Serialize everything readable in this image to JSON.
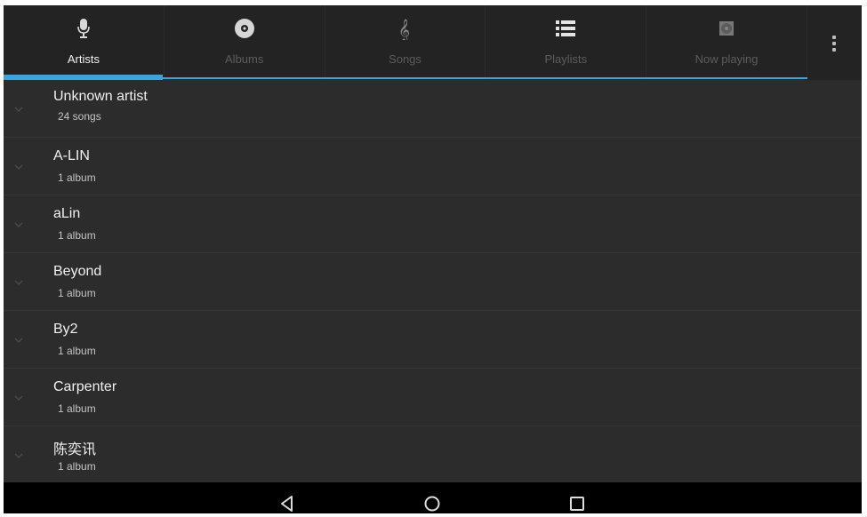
{
  "tabs": [
    {
      "label": "Artists",
      "icon": "microphone-icon",
      "active": true
    },
    {
      "label": "Albums",
      "icon": "disc-icon",
      "active": false
    },
    {
      "label": "Songs",
      "icon": "treble-clef-icon",
      "active": false
    },
    {
      "label": "Playlists",
      "icon": "list-icon",
      "active": false
    },
    {
      "label": "Now playing",
      "icon": "now-playing-icon",
      "active": false
    }
  ],
  "overflow_menu_icon": "more-vert-icon",
  "artists": [
    {
      "name": "Unknown artist",
      "count": "24 songs"
    },
    {
      "name": "A-LIN",
      "count": "1 album"
    },
    {
      "name": "aLin",
      "count": "1 album"
    },
    {
      "name": "Beyond",
      "count": "1 album"
    },
    {
      "name": "By2",
      "count": "1 album"
    },
    {
      "name": "Carpenter",
      "count": "1 album"
    },
    {
      "name": "陈奕讯",
      "count": "1 album"
    }
  ],
  "nav": {
    "back_icon": "back-icon",
    "home_icon": "home-icon",
    "recents_icon": "recents-icon"
  },
  "colors": {
    "accent": "#37a6dc",
    "background": "#2c2c2c",
    "tabbar": "#232323",
    "navbar": "#000000"
  }
}
